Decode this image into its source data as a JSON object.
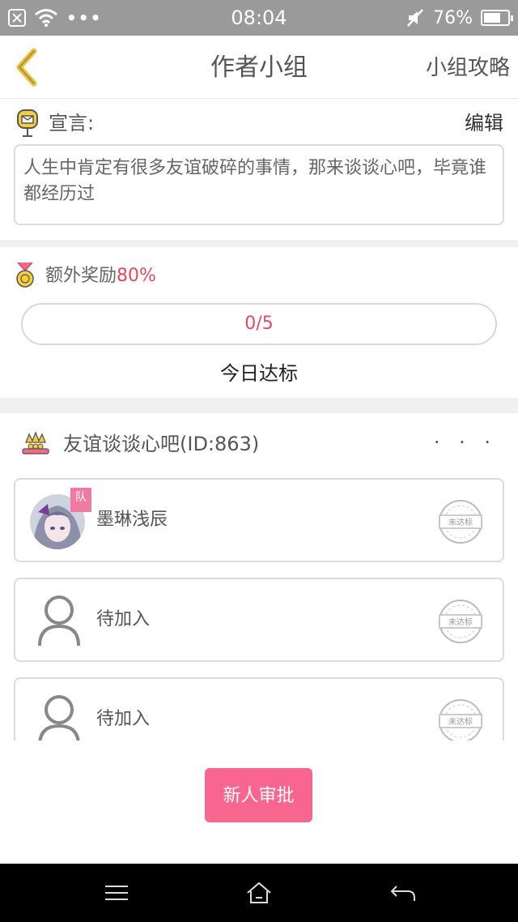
{
  "status_bar": {
    "time": "08:04",
    "battery": "76%",
    "battery_level": 0.76,
    "icons": [
      "close-box-icon",
      "wifi-icon",
      "more-dots-icon",
      "mute-icon",
      "battery-icon"
    ]
  },
  "nav": {
    "title": "作者小组",
    "right_label": "小组攻略",
    "back_icon": "chevron-left-icon"
  },
  "declaration": {
    "label": "宣言:",
    "edit_label": "编辑",
    "text": "人生中肯定有很多友谊破碎的事情，那来谈谈心吧，毕竟谁都经历过"
  },
  "reward": {
    "label": "额外奖励",
    "percent": "80%",
    "progress_text": "0/5",
    "progress_value": 0,
    "progress_total": 5,
    "today_label": "今日达标"
  },
  "group": {
    "name": "友谊谈谈心吧(ID:863)",
    "more_label": "· · ·",
    "members": [
      {
        "name": "墨琳浅辰",
        "badge": "队",
        "stamp": "未达标",
        "has_avatar": true
      },
      {
        "name": "待加入",
        "stamp": "未达标",
        "has_avatar": false
      },
      {
        "name": "待加入",
        "stamp": "未达标",
        "has_avatar": false
      }
    ]
  },
  "approve_button": "新人审批",
  "system_nav": [
    "menu-icon",
    "home-icon",
    "back-arrow-icon"
  ],
  "colors": {
    "accent_pink": "#f8658f",
    "accent_red_text": "#e14b5a",
    "gold": "#e8c23a",
    "status_bar": "#9a9a9a"
  }
}
